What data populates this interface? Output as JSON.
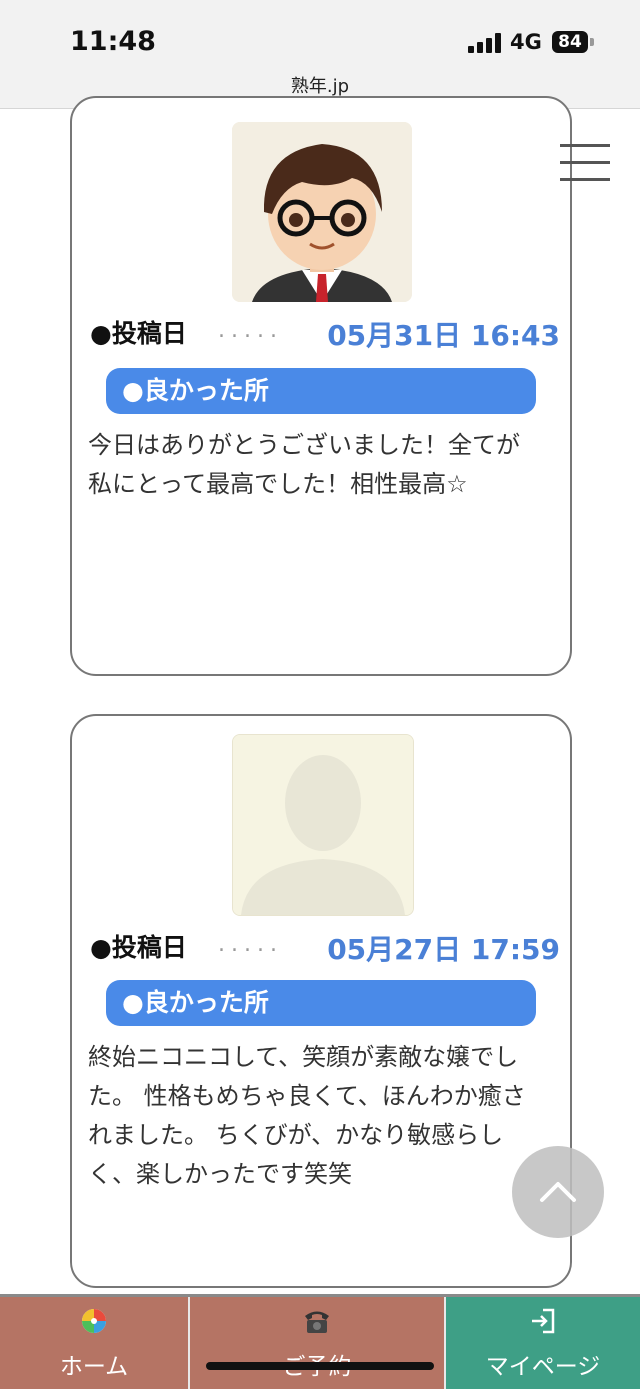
{
  "status_bar": {
    "time": "11:48",
    "network": "4G",
    "battery": "84"
  },
  "browser": {
    "url": "熟年.jp"
  },
  "reviews": [
    {
      "post_label": "●投稿日",
      "dots": ".....",
      "date": "05月31日 16:43",
      "pill": "●良かった所",
      "text": "今日はありがとうございました！全てが私にとって最高でした！相性最高☆"
    },
    {
      "post_label": "●投稿日",
      "dots": ".....",
      "date": "05月27日 17:59",
      "pill": "●良かった所",
      "text": "終始ニコニコして、笑顔が素敵な嬢でした。 性格もめちゃ良くて、ほんわか癒されました。 ちくびが、かなり敏感らしく、楽しかったです笑笑"
    }
  ],
  "nav": {
    "home": "ホーム",
    "reserve": "ご予約",
    "mypage": "マイページ"
  },
  "icons": {
    "menu": "hamburger-menu-icon",
    "scroll_top": "chevron-up-icon",
    "home": "beach-ball-icon",
    "reserve": "telephone-icon",
    "mypage": "login-icon"
  },
  "colors": {
    "date": "#4a80d6",
    "pill": "#4a8ae8",
    "nav_brown": "#b57464",
    "nav_green": "#3e9f86"
  }
}
